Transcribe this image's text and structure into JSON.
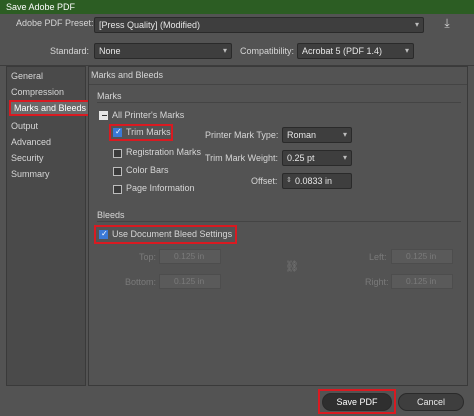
{
  "window": {
    "title": "Save Adobe PDF"
  },
  "top": {
    "preset_label": "Adobe PDF Preset:",
    "preset_value": "[Press Quality] (Modified)",
    "standard_label": "Standard:",
    "standard_value": "None",
    "compat_label": "Compatibility:",
    "compat_value": "Acrobat 5 (PDF 1.4)"
  },
  "sidebar": {
    "items": [
      "General",
      "Compression",
      "Marks and Bleeds",
      "Output",
      "Advanced",
      "Security",
      "Summary"
    ],
    "selected": "Marks and Bleeds"
  },
  "panel": {
    "title": "Marks and Bleeds",
    "marks": {
      "section": "Marks",
      "all_printers": "All Printer's Marks",
      "trim": "Trim Marks",
      "registration": "Registration Marks",
      "color_bars": "Color Bars",
      "page_info": "Page Information",
      "type_label": "Printer Mark Type:",
      "type_value": "Roman",
      "weight_label": "Trim Mark Weight:",
      "weight_value": "0.25 pt",
      "offset_label": "Offset:",
      "offset_value": "0.0833 in"
    },
    "bleeds": {
      "section": "Bleeds",
      "use_doc": "Use Document Bleed Settings",
      "top_label": "Top:",
      "top_value": "0.125 in",
      "bottom_label": "Bottom:",
      "bottom_value": "0.125 in",
      "left_label": "Left:",
      "left_value": "0.125 in",
      "right_label": "Right:",
      "right_value": "0.125 in"
    }
  },
  "buttons": {
    "save": "Save PDF",
    "cancel": "Cancel"
  }
}
